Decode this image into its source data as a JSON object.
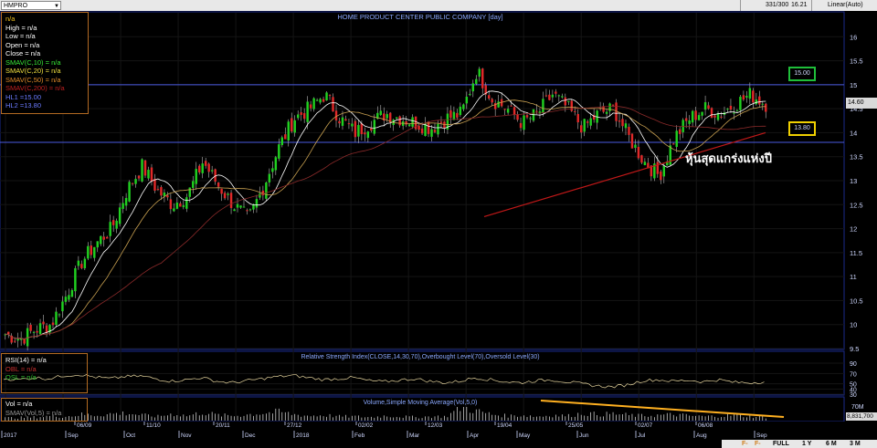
{
  "toolbar": {
    "symbol": "HMPRO",
    "counter": "331/300",
    "last": "16.21",
    "scale_mode": "Linear(Auto)"
  },
  "bottom_bar": {
    "buttons": [
      "FULL",
      "1 Y",
      "6 M",
      "3 M"
    ]
  },
  "main_legend": {
    "name": "n/a",
    "high": "High   = n/a",
    "low": "Low    = n/a",
    "open": "Open   = n/a",
    "close": "Close  = n/a",
    "sma10": "SMAV(C,10)   = n/a",
    "sma20": "SMAV(C,20)   = n/a",
    "sma50": "SMAV(C,50)   = n/a",
    "sma200": "SMAV(C,200)  = n/a",
    "hl1": "HL1 =15.00",
    "hl2": "HL2 =13.80"
  },
  "rsi_legend": {
    "rsi": "RSI(14)   = n/a",
    "obl": "OBL   = n/a",
    "osl": "OSL   = n/a"
  },
  "vol_legend": {
    "vol": "Vol    = n/a",
    "smav": "SMAV(Vol,5)   = n/a"
  },
  "annotation": "หุ้นสุดแกร่งแห่งปี",
  "hl1_tag": "15.00",
  "hl2_tag": "13.80",
  "last_price": "14.60",
  "last_volume": "8,831,700",
  "colors": {
    "up": "#20d020",
    "down": "#e02828",
    "sma10": "#ffffff",
    "sma20": "#c8a050",
    "sma50": "#8b2a2a",
    "trend": "#c01818",
    "hl": "#4a5ae0",
    "vol_trend": "#ffb020",
    "rsi": "#e8d7a0"
  },
  "chart_data": [
    {
      "type": "candlestick",
      "title": "HOME PRODUCT CENTER PUBLIC COMPANY [day]",
      "ylim": [
        9.5,
        16.5
      ],
      "yticks": [
        9.5,
        10,
        10.5,
        11,
        11.5,
        12,
        12.5,
        13,
        13.5,
        14,
        14.5,
        15,
        15.5,
        16
      ],
      "horizontal_lines": [
        15.0,
        13.8
      ],
      "trendline": {
        "from": [
          "Mar-2018",
          12.25
        ],
        "to": [
          "Sep-2018",
          14.0
        ]
      },
      "month_axis": [
        "2017",
        "Sep",
        "Oct",
        "Nov",
        "Dec",
        "2018",
        "Feb",
        "Mar",
        "Apr",
        "May",
        "Jun",
        "Jul",
        "Aug",
        "Sep"
      ],
      "date_axis": [
        "06/09",
        "11/10",
        "20/11",
        "27/12",
        "02/02",
        "12/03",
        "19/04",
        "25/05",
        "02/07",
        "06/08"
      ],
      "close_series": [
        9.8,
        9.7,
        9.9,
        10.0,
        10.6,
        11.3,
        11.7,
        12.0,
        12.8,
        13.3,
        12.8,
        12.5,
        12.7,
        13.4,
        12.9,
        12.5,
        12.2,
        12.9,
        13.7,
        14.3,
        14.5,
        14.8,
        14.3,
        14.0,
        14.2,
        14.4,
        14.3,
        14.2,
        14.1,
        14.3,
        14.4,
        15.3,
        14.7,
        14.5,
        14.2,
        14.4,
        14.8,
        14.5,
        14.1,
        14.4,
        14.5,
        13.9,
        13.4,
        13.1,
        13.9,
        14.3,
        14.5,
        14.4,
        14.6,
        14.8,
        14.6
      ]
    },
    {
      "type": "line",
      "title": "Relative Strength Index(CLOSE,14,30,70),Overbought Level(70),Oversold Level(30)",
      "ylim": [
        30,
        90
      ],
      "yticks": [
        90,
        70,
        50,
        40,
        30
      ],
      "values": [
        60,
        58,
        62,
        60,
        66,
        68,
        63,
        60,
        64,
        65,
        60,
        55,
        58,
        62,
        55,
        52,
        56,
        60,
        64,
        66,
        62,
        58,
        60,
        62,
        56,
        54,
        57,
        60,
        55,
        52,
        55,
        62,
        58,
        54,
        52,
        56,
        58,
        54,
        50,
        46,
        44,
        48,
        56,
        58,
        55,
        57,
        54,
        58,
        53,
        52,
        54
      ]
    },
    {
      "type": "bar",
      "title": "Volume,Simple Moving Average(Vol,5,0)",
      "yticks": [
        "70M"
      ],
      "values": [
        8,
        9,
        10,
        14,
        12,
        18,
        16,
        20,
        22,
        16,
        12,
        20,
        14,
        24,
        16,
        14,
        18,
        22,
        26,
        18,
        14,
        16,
        12,
        12,
        10,
        14,
        12,
        10,
        12,
        12,
        40,
        28,
        18,
        14,
        16,
        12,
        16,
        14,
        22,
        18,
        20,
        16,
        14,
        16,
        18,
        14,
        12,
        14,
        16,
        12,
        10
      ]
    }
  ]
}
